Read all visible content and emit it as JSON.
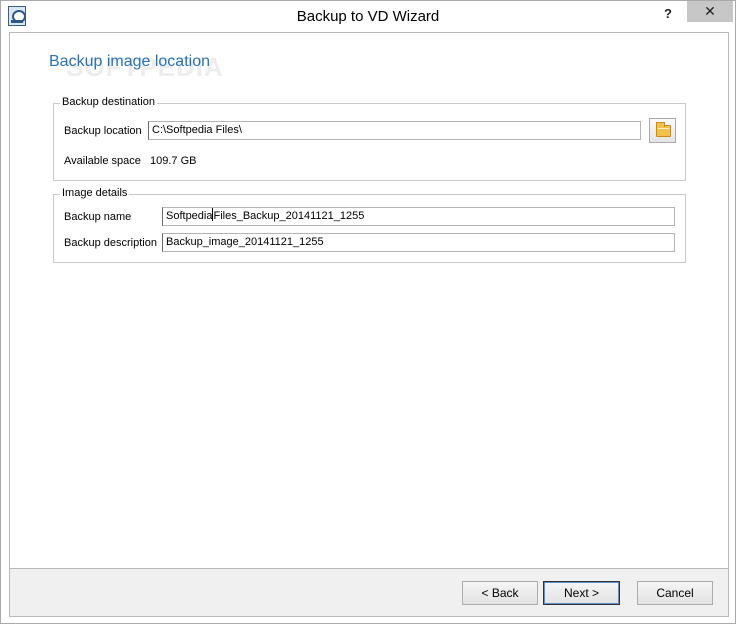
{
  "window": {
    "title": "Backup to VD Wizard",
    "help_label": "?",
    "close_label": "✕"
  },
  "page": {
    "title": "Backup image location",
    "watermark": "SOFTPEDIA"
  },
  "backup_destination": {
    "legend": "Backup destination",
    "location_label": "Backup location",
    "location_value": "C:\\Softpedia Files\\",
    "available_label": "Available space",
    "available_value": "109.7 GB"
  },
  "image_details": {
    "legend": "Image details",
    "name_label": "Backup name",
    "name_value_before_caret": "Softpedia",
    "name_value_after_caret": "Files_Backup_20141121_1255",
    "description_label": "Backup description",
    "description_value": "Backup_image_20141121_1255"
  },
  "buttons": {
    "back": "< Back",
    "next": "Next >",
    "cancel": "Cancel"
  },
  "icons": {
    "app": "wizard-app-icon",
    "browse": "folder-icon"
  }
}
